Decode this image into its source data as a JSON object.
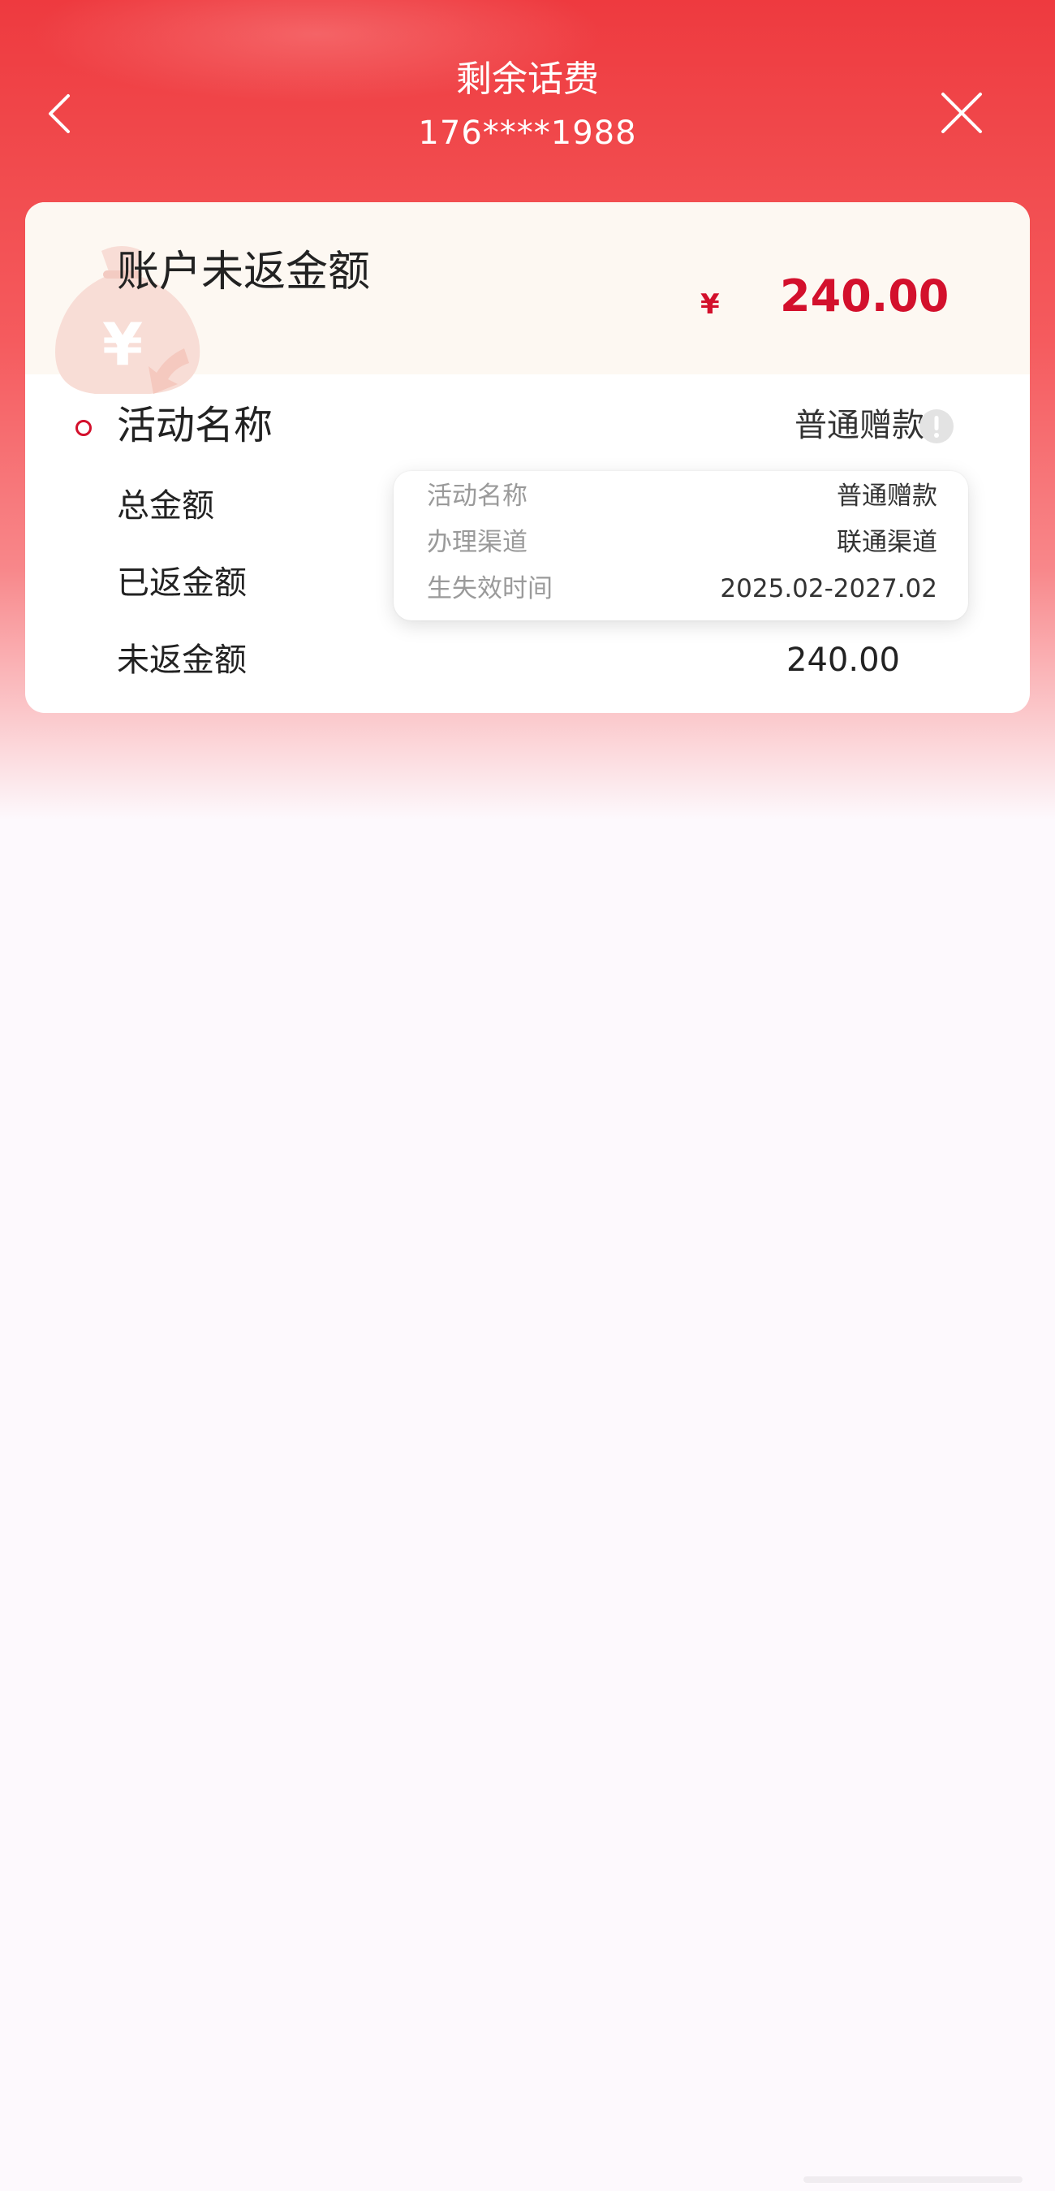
{
  "header": {
    "title": "剩余话费",
    "phone": "176****1988"
  },
  "summary": {
    "title": "账户未返金额",
    "currency": "¥",
    "amount": "240.00"
  },
  "activity": {
    "name_label": "活动名称",
    "name_value": "普通赠款",
    "rows": [
      {
        "label": "总金额",
        "value": ""
      },
      {
        "label": "已返金额",
        "value": ""
      },
      {
        "label": "未返金额",
        "value": "240.00"
      }
    ]
  },
  "tooltip": {
    "rows": [
      {
        "label": "活动名称",
        "value": "普通赠款"
      },
      {
        "label": "办理渠道",
        "value": "联通渠道"
      },
      {
        "label": "生失效时间",
        "value": "2025.02-2027.02"
      }
    ]
  },
  "colors": {
    "brand_red": "#d3102c",
    "header_red": "#ee3a3f",
    "card_top_bg": "#fdf8f2"
  },
  "icons": {
    "back": "chevron-left-icon",
    "close": "close-icon",
    "info": "exclamation-info-icon",
    "moneybag": "money-bag-icon"
  }
}
